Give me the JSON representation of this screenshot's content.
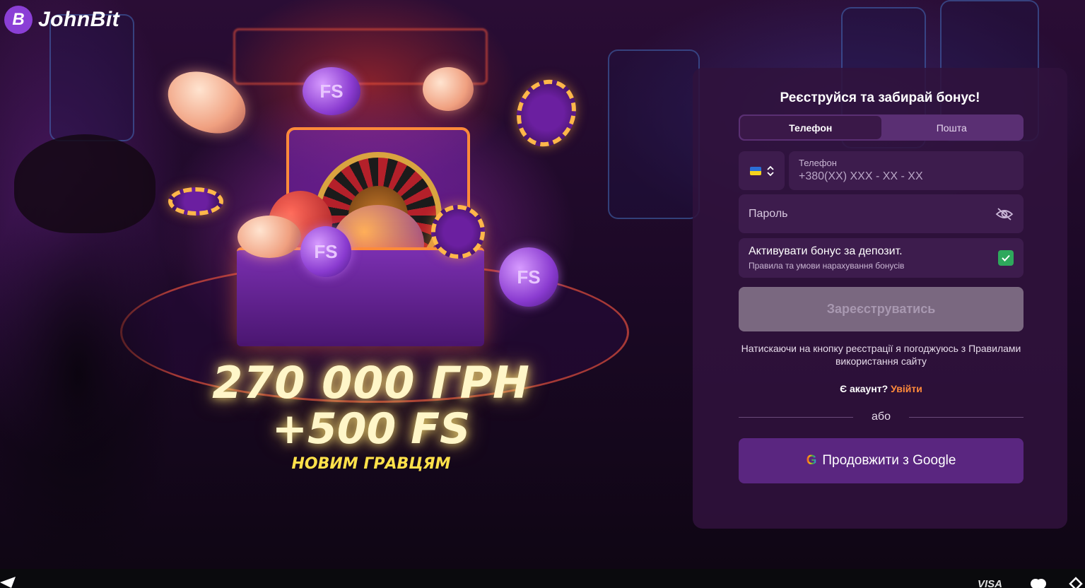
{
  "brand": {
    "name": "JohnBit",
    "logo_letter": "B"
  },
  "promo": {
    "amount": "270 000 ГРН",
    "freespins": "+500 FS",
    "subtitle": "НОВИМ ГРАВЦЯМ",
    "coin_label": "FS"
  },
  "form": {
    "title": "Реєструйся та забирай бонус!",
    "tabs": [
      {
        "label": "Телефон",
        "active": true
      },
      {
        "label": "Пошта",
        "active": false
      }
    ],
    "country": {
      "flag": "ukraine-flag-icon"
    },
    "phone": {
      "label": "Телефон",
      "placeholder": "+380(XX) XXX - XX - XX"
    },
    "password": {
      "placeholder": "Пароль",
      "icon": "eye-off-icon"
    },
    "bonus": {
      "title": "Активувати бонус за депозит.",
      "subtitle": "Правила та умови нарахування бонусів",
      "checked": true
    },
    "register_label": "Зареєструватись",
    "terms": "Натискаючи на кнопку реєстрації я погоджуюсь з Правилами використання сайту",
    "account_question": "Є акаунт?",
    "login_label": "Увійти",
    "or_label": "або",
    "google_label": "Продовжити з Google"
  },
  "footer": {
    "visa": "VISA"
  },
  "colors": {
    "accent_orange": "#ff8a3a",
    "panel_bg": "#30123c",
    "google_button": "#5a2680",
    "check_green": "#2ea85c"
  }
}
